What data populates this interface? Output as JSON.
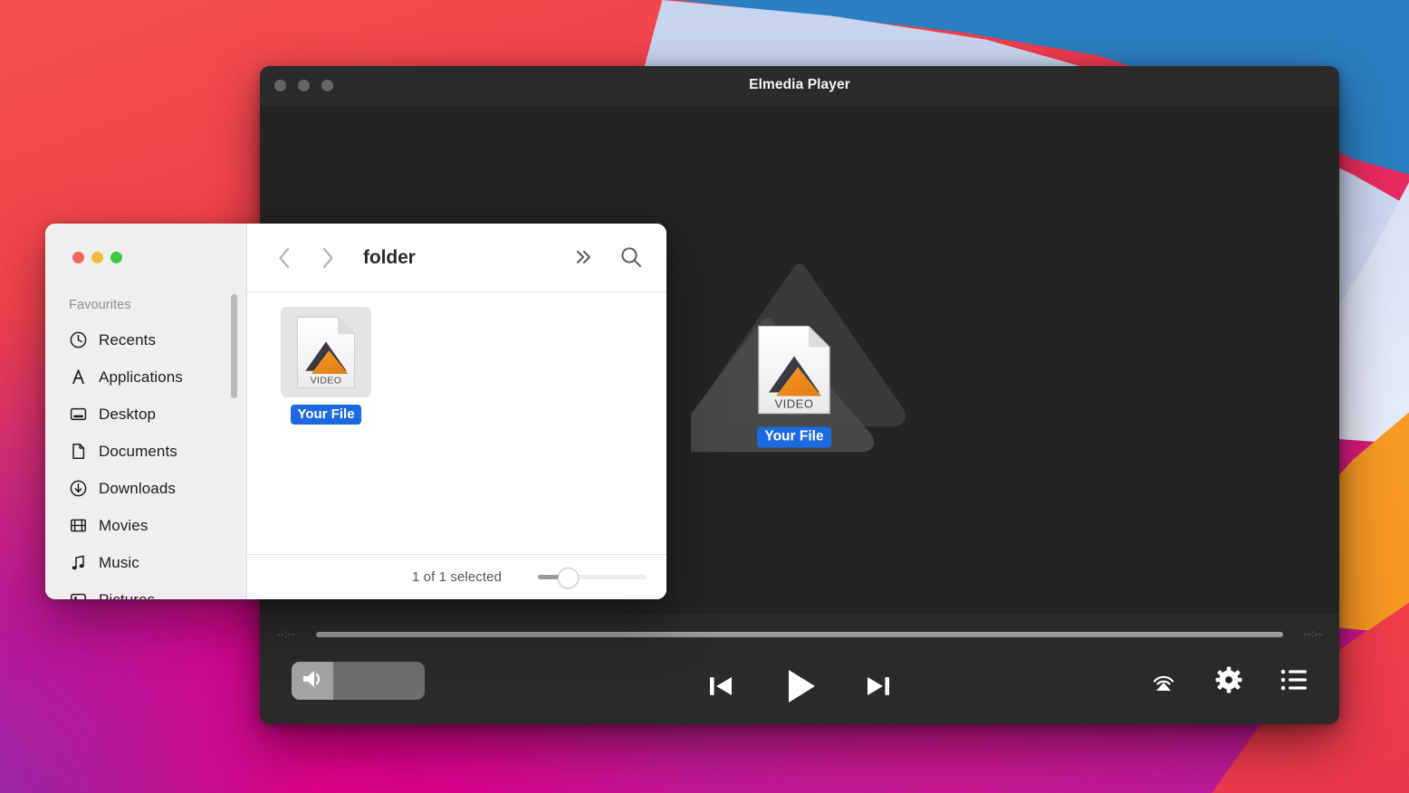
{
  "desktop": {
    "wallpaper_name": "bigsur-gradient-wallpaper",
    "colors": {
      "red": "#f0414a",
      "magenta": "#e5007e",
      "purple": "#8e2fae",
      "blue": "#2b7fc0",
      "lavender": "#cdd9f0",
      "orange": "#f79b22"
    }
  },
  "player": {
    "title": "Elmedia Player",
    "traffic_lights": [
      {
        "name": "close",
        "color": "#656565"
      },
      {
        "name": "minimize",
        "color": "#656565"
      },
      {
        "name": "zoom",
        "color": "#656565"
      }
    ],
    "stage": {
      "watermark_alt": "elmedia-logo-watermark",
      "drag_file_label": "Your File",
      "drag_file_type_text": "VIDEO"
    },
    "timeline": {
      "elapsed": "--:--",
      "remaining": "--:--",
      "progress_percent": 0
    },
    "volume": {
      "icon": "speaker-icon",
      "level_percent": 31
    },
    "transport": {
      "previous_label": "previous-track-icon",
      "play_label": "play-icon",
      "next_label": "next-track-icon"
    },
    "right_controls": [
      {
        "name": "airplay-icon",
        "label": "AirPlay"
      },
      {
        "name": "gear-icon",
        "label": "Settings"
      },
      {
        "name": "playlist-icon",
        "label": "Playlist"
      }
    ]
  },
  "finder": {
    "title": "folder",
    "traffic_lights": [
      {
        "name": "close",
        "color": "#f3655b"
      },
      {
        "name": "minimize",
        "color": "#f5bb3f"
      },
      {
        "name": "zoom",
        "color": "#41c84a"
      }
    ],
    "toolbar": {
      "back_icon": "chevron-left-icon",
      "forward_icon": "chevron-right-icon",
      "more_icon": "chevron-double-right-icon",
      "search_icon": "search-icon"
    },
    "sidebar": {
      "header": "Favourites",
      "items": [
        {
          "label": "Recents",
          "icon": "clock-icon"
        },
        {
          "label": "Applications",
          "icon": "applications-icon"
        },
        {
          "label": "Desktop",
          "icon": "desktop-icon"
        },
        {
          "label": "Documents",
          "icon": "document-icon"
        },
        {
          "label": "Downloads",
          "icon": "download-icon"
        },
        {
          "label": "Movies",
          "icon": "film-icon"
        },
        {
          "label": "Music",
          "icon": "music-note-icon"
        },
        {
          "label": "Pictures",
          "icon": "picture-icon"
        }
      ]
    },
    "files": [
      {
        "name": "Your File",
        "type_text": "VIDEO",
        "selected": true
      }
    ],
    "status": {
      "text": "1 of 1 selected",
      "zoom_percent": 28
    }
  }
}
